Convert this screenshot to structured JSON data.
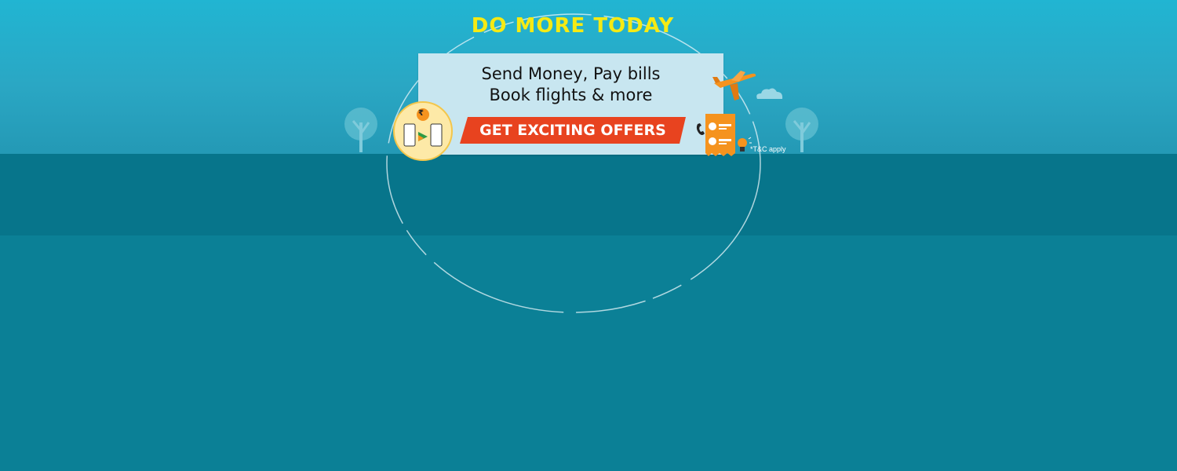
{
  "banner": {
    "headline": "DO MORE TODAY",
    "subline_1": "Send Money, Pay bills",
    "subline_2": "Book flights & more",
    "cta_label": "GET EXCITING OFFERS",
    "terms": "*T&C apply",
    "rupee_symbol": "₹"
  },
  "colors": {
    "headline": "#f5ea14",
    "cta": "#e8431f",
    "panel": "#c8e6f0",
    "accent_orange": "#f5931e"
  },
  "icons": [
    "tree-icon",
    "payment-medallion-icon",
    "airplane-icon",
    "cloud-icon",
    "phone-icon",
    "bill-receipt-icon",
    "lightbulb-icon"
  ]
}
